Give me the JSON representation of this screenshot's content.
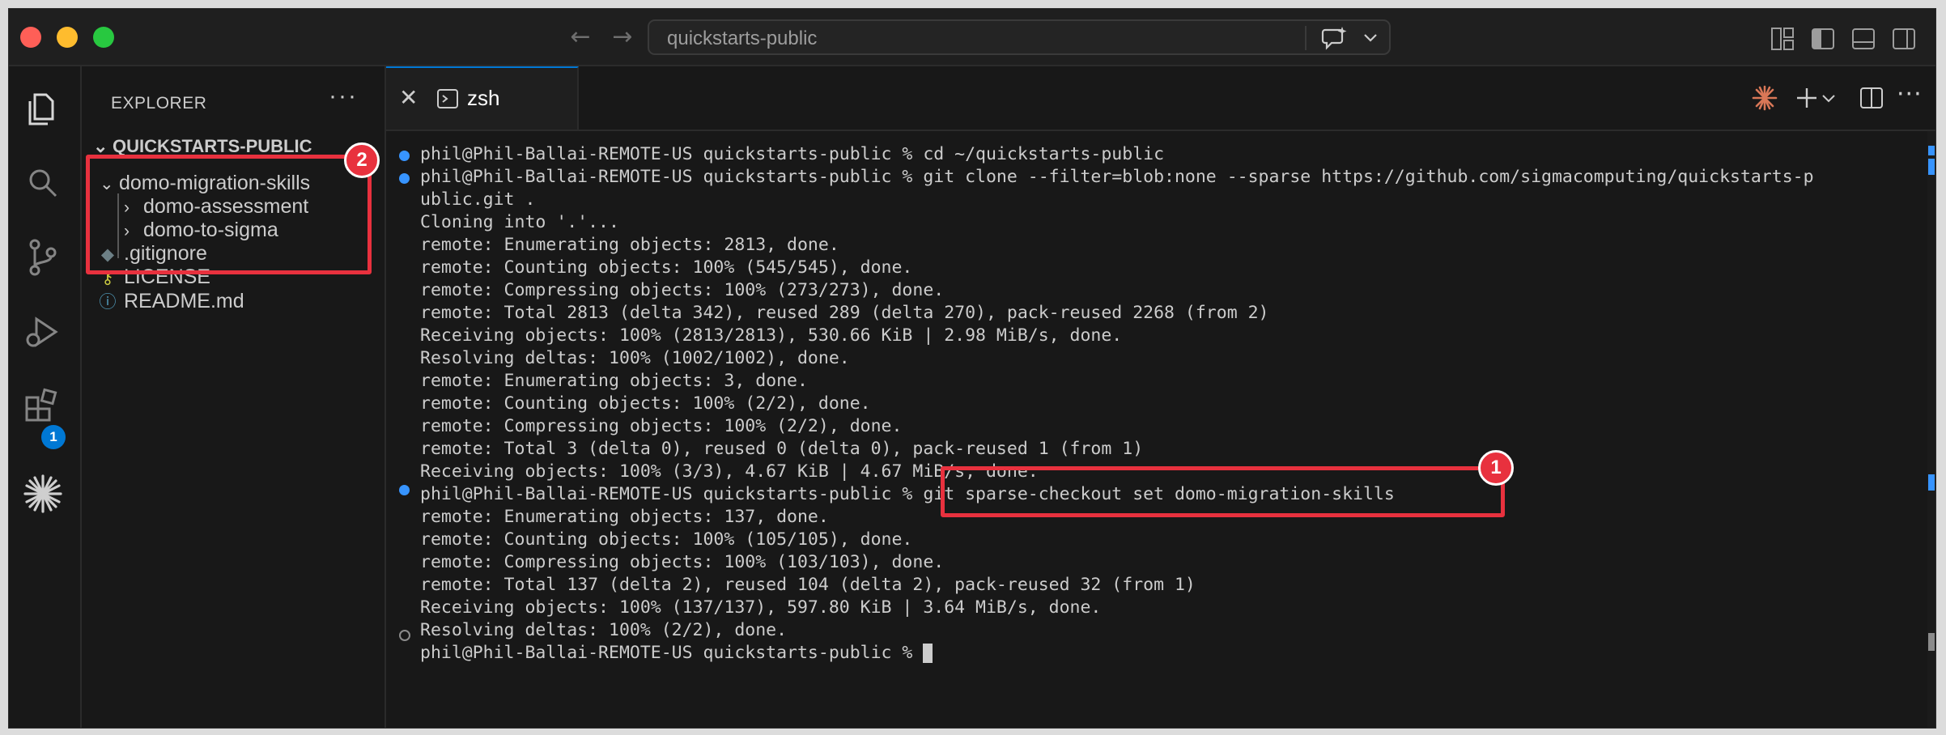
{
  "titlebar": {
    "search_text": "quickstarts-public",
    "icons": [
      "back-icon",
      "forward-icon",
      "chat-sparkle-icon",
      "chevron-down-icon",
      "customize-layout-icon",
      "toggle-sidebar-icon",
      "toggle-panel-icon",
      "toggle-secondary-sidebar-icon"
    ]
  },
  "activity_bar": {
    "icons": [
      "explorer-icon",
      "search-icon",
      "source-control-icon",
      "run-debug-icon",
      "extensions-icon",
      "claude-icon"
    ],
    "extensions_badge": "1"
  },
  "sidebar": {
    "title": "EXPLORER",
    "more": "···",
    "root": "QUICKSTARTS-PUBLIC",
    "items": [
      {
        "label": "domo-migration-skills",
        "chevron": "⌄"
      },
      {
        "label": "domo-assessment",
        "chevron": "›"
      },
      {
        "label": "domo-to-sigma",
        "chevron": "›"
      },
      {
        "label": ".gitignore",
        "icon": "git-file-icon"
      },
      {
        "label": "LICENSE",
        "icon": "license-key-icon"
      },
      {
        "label": "README.md",
        "icon": "info-icon"
      }
    ]
  },
  "terminal_tab": {
    "label": "zsh",
    "close": "✕"
  },
  "terminal": {
    "lines": [
      "phil@Phil-Ballai-REMOTE-US quickstarts-public % cd ~/quickstarts-public",
      "phil@Phil-Ballai-REMOTE-US quickstarts-public % git clone --filter=blob:none --sparse https://github.com/sigmacomputing/quickstarts-p",
      "ublic.git .",
      "Cloning into '.'...",
      "remote: Enumerating objects: 2813, done.",
      "remote: Counting objects: 100% (545/545), done.",
      "remote: Compressing objects: 100% (273/273), done.",
      "remote: Total 2813 (delta 342), reused 289 (delta 270), pack-reused 2268 (from 2)",
      "Receiving objects: 100% (2813/2813), 530.66 KiB | 2.98 MiB/s, done.",
      "Resolving deltas: 100% (1002/1002), done.",
      "remote: Enumerating objects: 3, done.",
      "remote: Counting objects: 100% (2/2), done.",
      "remote: Compressing objects: 100% (2/2), done.",
      "remote: Total 3 (delta 0), reused 0 (delta 0), pack-reused 1 (from 1)",
      "Receiving objects: 100% (3/3), 4.67 KiB | 4.67 MiB/s, done.",
      "phil@Phil-Ballai-REMOTE-US quickstarts-public % git sparse-checkout set domo-migration-skills",
      "remote: Enumerating objects: 137, done.",
      "remote: Counting objects: 100% (105/105), done.",
      "remote: Compressing objects: 100% (103/103), done.",
      "remote: Total 137 (delta 2), reused 104 (delta 2), pack-reused 32 (from 1)",
      "Receiving objects: 100% (137/137), 597.80 KiB | 3.64 MiB/s, done.",
      "Resolving deltas: 100% (2/2), done.",
      "phil@Phil-Ballai-REMOTE-US quickstarts-public % "
    ]
  },
  "annotations": {
    "one": "1",
    "two": "2"
  },
  "colors": {
    "annotation_red": "#e8313e",
    "accent_blue": "#0078d4",
    "background": "#181818"
  }
}
